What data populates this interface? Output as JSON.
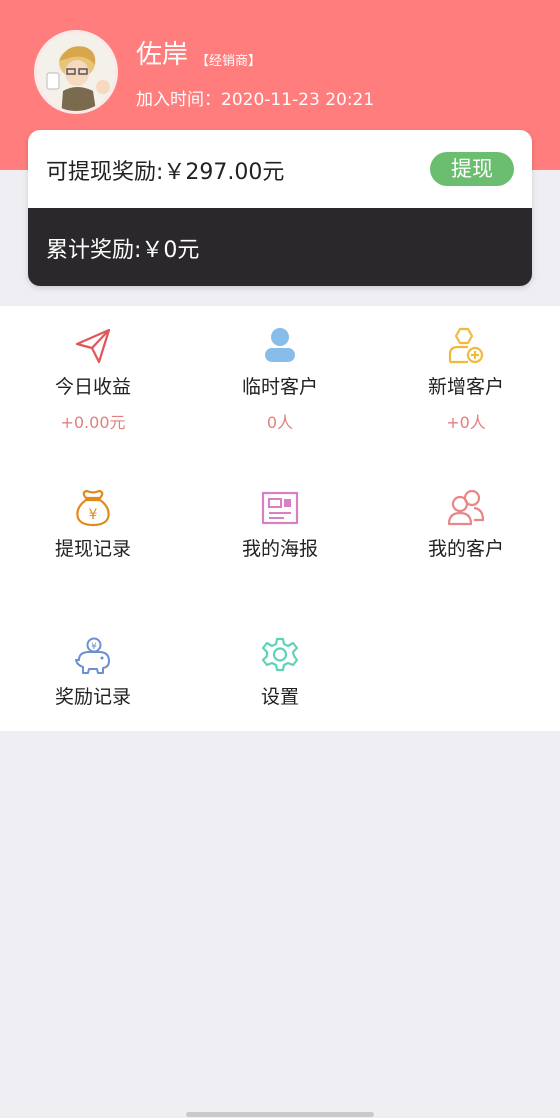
{
  "user": {
    "name": "佐岸",
    "tag": "【经销商】",
    "join_time": "加入时间：2020-11-23 20:21"
  },
  "balance": {
    "withdrawable": "可提现奖励:￥297.00元",
    "withdraw_button": "提现",
    "total_reward": "累计奖励:￥0元"
  },
  "menu": [
    {
      "label": "今日收益",
      "value": "+0.00元",
      "icon": "paper-plane-icon"
    },
    {
      "label": "临时客户",
      "value": "0人",
      "icon": "user-icon"
    },
    {
      "label": "新增客户",
      "value": "+0人",
      "icon": "user-add-icon"
    },
    {
      "label": "提现记录",
      "icon": "money-bag-icon"
    },
    {
      "label": "我的海报",
      "icon": "poster-icon"
    },
    {
      "label": "我的客户",
      "icon": "users-icon"
    },
    {
      "label": "奖励记录",
      "icon": "piggy-bank-icon"
    },
    {
      "label": "设置",
      "icon": "gear-icon"
    }
  ],
  "colors": {
    "header_bg": "#ff7d7d",
    "withdraw_button_bg": "#6bbd6f",
    "dark_card_bg": "#2a282b",
    "value_text": "#e0817f"
  }
}
